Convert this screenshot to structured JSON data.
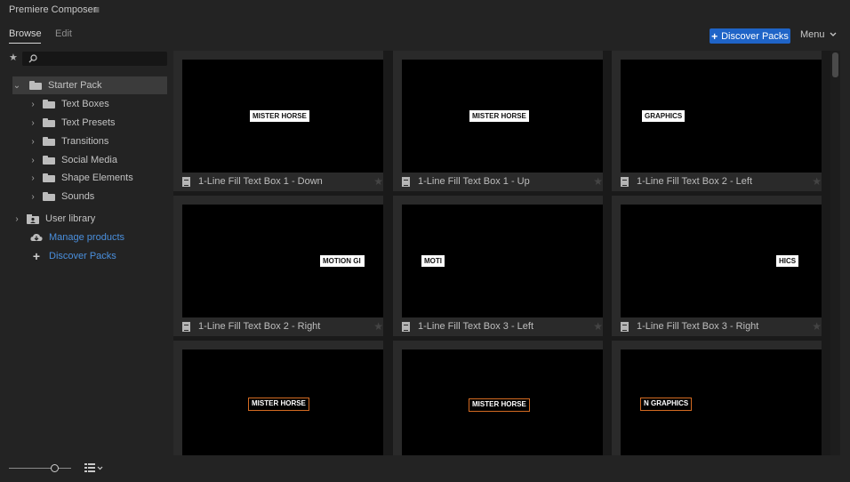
{
  "app": {
    "title": "Premiere Composer"
  },
  "tabs": [
    {
      "label": "Browse",
      "active": true
    },
    {
      "label": "Edit",
      "active": false
    }
  ],
  "header": {
    "discover_label": "Discover Packs",
    "menu_label": "Menu"
  },
  "sidebar": {
    "search": {
      "placeholder": "",
      "value": ""
    },
    "root": {
      "label": "Starter Pack",
      "expanded": true
    },
    "folders": [
      "Text Boxes",
      "Text Presets",
      "Transitions",
      "Social Media",
      "Shape Elements",
      "Sounds"
    ],
    "user_library": "User library",
    "manage_products": "Manage products",
    "discover_packs": "Discover Packs"
  },
  "grid": {
    "items": [
      {
        "name": "1-Line Fill Text Box 1 - Down",
        "preview_text": "MISTER HORSE"
      },
      {
        "name": "1-Line Fill Text Box 1 - Up",
        "preview_text": "MISTER HORSE"
      },
      {
        "name": "1-Line Fill Text Box 2 - Left",
        "preview_text": "GRAPHICS"
      },
      {
        "name": "1-Line Fill Text Box 2 - Right",
        "preview_text": "MOTION GI"
      },
      {
        "name": "1-Line Fill Text Box 3 - Left",
        "preview_text": "MOTI"
      },
      {
        "name": "1-Line Fill Text Box 3 - Right",
        "preview_text": "HICS"
      },
      {
        "name": "",
        "preview_text": "MISTER HORSE"
      },
      {
        "name": "",
        "preview_text": "MISTER HORSE"
      },
      {
        "name": "",
        "preview_text": "N GRAPHICS"
      }
    ]
  },
  "colors": {
    "accent": "#1f64c7",
    "link": "#4a8fdd",
    "outline_tag": "#d36a21"
  },
  "icons": [
    "hamburger-icon",
    "star-icon",
    "search-icon",
    "folder-icon",
    "chevron-right-icon",
    "chevron-down-icon",
    "user-library-icon",
    "cloud-download-icon",
    "plus-icon",
    "document-icon",
    "list-view-icon"
  ]
}
